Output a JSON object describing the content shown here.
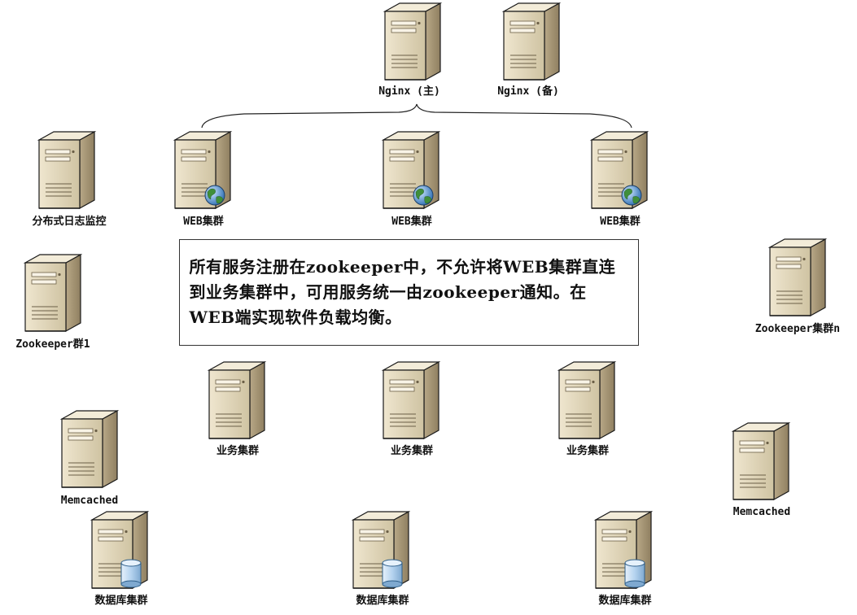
{
  "diagram": {
    "note": "所有服务注册在zookeeper中，不允许将WEB集群直连到业务集群中，可用服务统一由zookeeper通知。在WEB端实现软件负载均衡。",
    "nodes": [
      {
        "id": "nginx-main",
        "label": "Nginx (主)",
        "badge": "none"
      },
      {
        "id": "nginx-backup",
        "label": "Nginx (备)",
        "badge": "none"
      },
      {
        "id": "log-monitor",
        "label": "分布式日志监控",
        "badge": "none"
      },
      {
        "id": "web-1",
        "label": "WEB集群",
        "badge": "globe-icon"
      },
      {
        "id": "web-2",
        "label": "WEB集群",
        "badge": "globe-icon"
      },
      {
        "id": "web-3",
        "label": "WEB集群",
        "badge": "globe-icon"
      },
      {
        "id": "zookeeper-1",
        "label": "Zookeeper群1",
        "badge": "none"
      },
      {
        "id": "zookeeper-n",
        "label": "Zookeeper集群n",
        "badge": "none"
      },
      {
        "id": "service-1",
        "label": "业务集群",
        "badge": "none"
      },
      {
        "id": "service-2",
        "label": "业务集群",
        "badge": "none"
      },
      {
        "id": "service-3",
        "label": "业务集群",
        "badge": "none"
      },
      {
        "id": "memcached-1",
        "label": "Memcached",
        "badge": "none"
      },
      {
        "id": "memcached-2",
        "label": "Memcached",
        "badge": "none"
      },
      {
        "id": "db-1",
        "label": "数据库集群",
        "badge": "database-icon"
      },
      {
        "id": "db-2",
        "label": "数据库集群",
        "badge": "database-icon"
      },
      {
        "id": "db-3",
        "label": "数据库集群",
        "badge": "database-icon"
      }
    ],
    "colors": {
      "server_front": "#ddd3b8",
      "server_side": "#a99878",
      "server_top": "#f3ecd9",
      "outline": "#1a1a1a",
      "globe": "#3f8f3a",
      "database": "#9cc3e6"
    }
  }
}
